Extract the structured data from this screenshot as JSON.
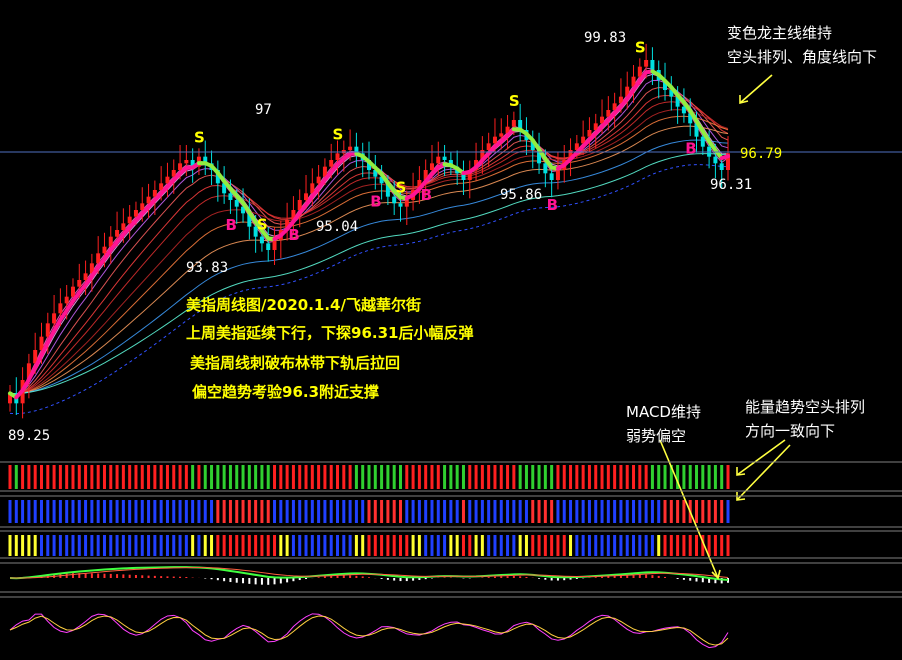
{
  "colors": {
    "background": "#000000",
    "up_candle": "#ff2020",
    "down_candle": "#00e0e0",
    "dragon_line_bull": "#ff1493",
    "dragon_line_bear": "#90ee40",
    "text_note": "#ffff00",
    "label": "#ffffff",
    "price_line": "#6080ff",
    "signal_s": "#ffff00",
    "signal_b": "#ff1493"
  },
  "price_labels": {
    "high": "99.83",
    "p97": "97",
    "low_start": "89.25",
    "low_9383": "93.83",
    "low_9504": "95.04",
    "low_9586": "95.86",
    "low_9631": "96.31",
    "last": "96.79"
  },
  "annotations": {
    "top_right_line1": "变色龙主线维持",
    "top_right_line2": "空头排列、角度线向下",
    "macd_line1": "MACD维持",
    "macd_line2": "弱势偏空",
    "energy_line1": "能量趋势空头排列",
    "energy_line2": "方向一致向下"
  },
  "notes": {
    "line1": "美指周线图/2020.1.4/飞越華尔街",
    "line2": "上周美指延续下行，下探96.31后小幅反弹",
    "line3": "美指周线刺破布林带下轨后拉回",
    "line4": "偏空趋势考验96.3附近支撑"
  },
  "signals": [
    {
      "label": "S",
      "color": "#ffff00"
    },
    {
      "label": "B",
      "color": "#ff1493"
    },
    {
      "label": "S",
      "color": "#ffff00"
    },
    {
      "label": "B",
      "color": "#ff1493"
    },
    {
      "label": "S",
      "color": "#ffff00"
    },
    {
      "label": "B",
      "color": "#ff1493"
    },
    {
      "label": "S",
      "color": "#ffff00"
    },
    {
      "label": "B",
      "color": "#ff1493"
    },
    {
      "label": "S",
      "color": "#ffff00"
    },
    {
      "label": "B",
      "color": "#ff1493"
    },
    {
      "label": "S",
      "color": "#ffff00"
    },
    {
      "label": "B",
      "color": "#ff1493"
    }
  ],
  "chart_data": {
    "type": "candlestick",
    "title": "",
    "ylim": [
      88.5,
      100.8
    ],
    "close": [
      89.6,
      89.3,
      90.0,
      90.5,
      90.9,
      91.3,
      91.7,
      92.0,
      92.3,
      92.5,
      92.8,
      93.0,
      93.2,
      93.5,
      93.8,
      94.0,
      94.3,
      94.5,
      94.7,
      94.9,
      95.1,
      95.3,
      95.5,
      95.7,
      95.9,
      96.1,
      96.3,
      96.5,
      96.6,
      96.4,
      96.7,
      96.5,
      96.3,
      95.9,
      95.6,
      95.4,
      95.2,
      95.0,
      94.6,
      94.3,
      94.1,
      93.9,
      94.2,
      94.5,
      94.8,
      95.1,
      95.4,
      95.6,
      95.9,
      96.1,
      96.4,
      96.6,
      96.8,
      96.9,
      97.0,
      96.8,
      96.6,
      96.3,
      96.1,
      95.9,
      95.5,
      95.3,
      95.2,
      95.4,
      95.7,
      96.0,
      96.3,
      96.5,
      96.7,
      96.6,
      96.4,
      96.2,
      96.0,
      96.3,
      96.6,
      96.9,
      97.1,
      97.3,
      97.4,
      97.6,
      97.8,
      97.5,
      97.2,
      96.9,
      96.5,
      96.2,
      96.0,
      96.3,
      96.6,
      96.9,
      97.1,
      97.3,
      97.5,
      97.7,
      97.9,
      98.1,
      98.3,
      98.5,
      98.8,
      99.1,
      99.4,
      99.6,
      99.3,
      99.0,
      98.7,
      98.5,
      98.2,
      98.0,
      97.7,
      97.3,
      97.0,
      96.7,
      96.5,
      96.3,
      96.8
    ],
    "volume_bars_note": "ribbon indicators rendered as colored bars"
  }
}
